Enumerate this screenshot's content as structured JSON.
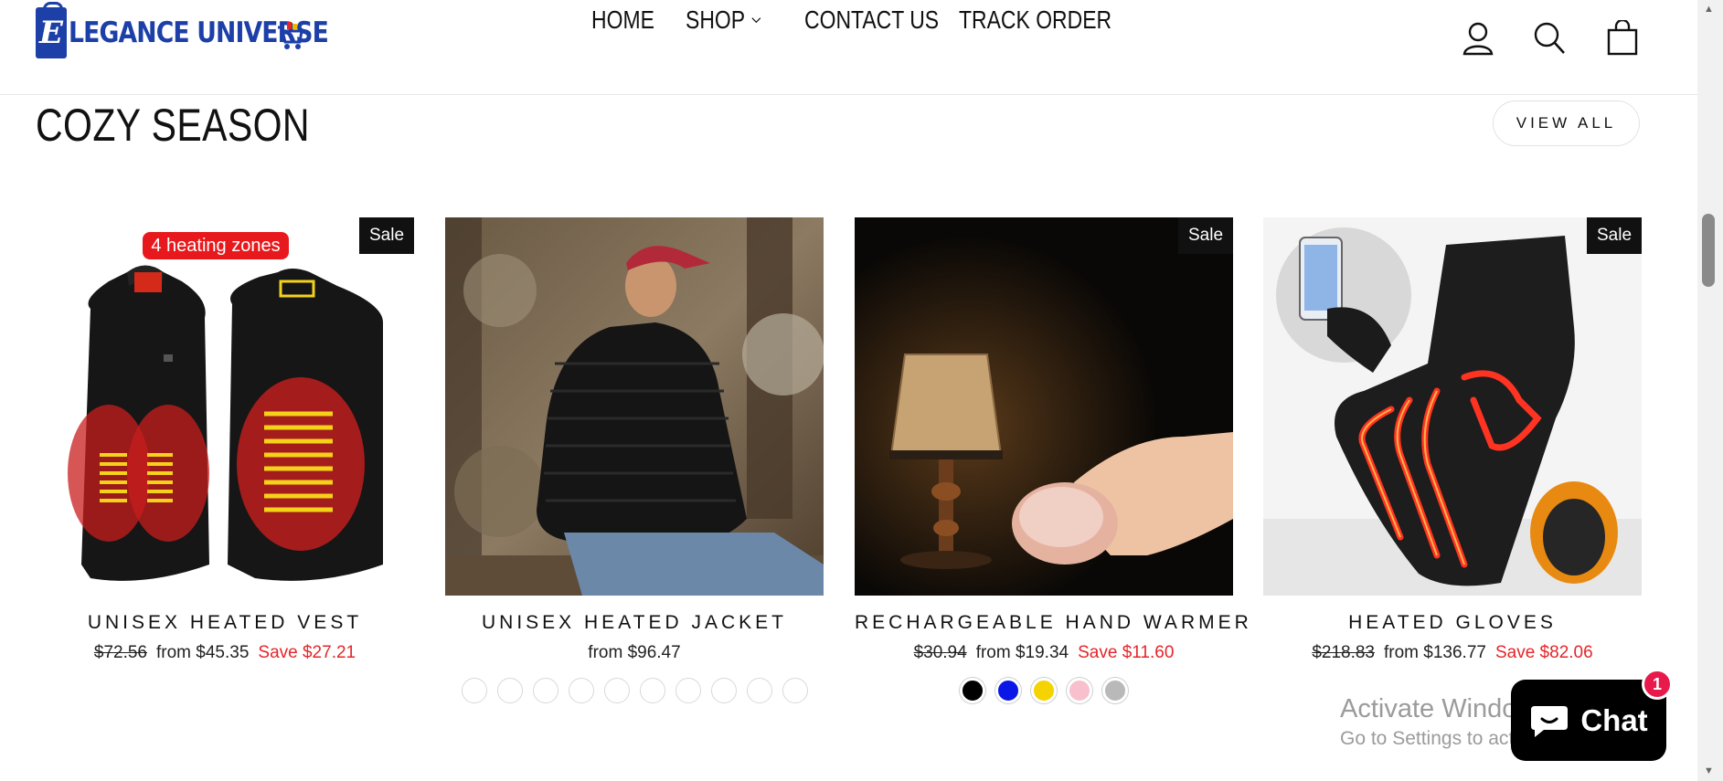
{
  "header": {
    "logo_text": "LEGANCE UNIVERSE",
    "logo_letter": "E",
    "nav": {
      "home": "HOME",
      "shop": "SHOP",
      "contact": "CONTACT US",
      "track": "TRACK ORDER"
    },
    "icons": [
      "user-icon",
      "search-icon",
      "bag-icon"
    ]
  },
  "section": {
    "title": "COZY SEASON",
    "view_all": "VIEW ALL"
  },
  "products": [
    {
      "name": "UNISEX HEATED VEST",
      "badge": "Sale",
      "original_price": "$72.56",
      "price": "from $45.35",
      "save": "Save $27.21",
      "image_label": "4 heating zones"
    },
    {
      "name": "UNISEX HEATED JACKET",
      "price": "from $96.47",
      "swatch_count": 10
    },
    {
      "name": "RECHARGEABLE HAND WARMER",
      "badge": "Sale",
      "original_price": "$30.94",
      "price": "from $19.34",
      "save": "Save $11.60",
      "swatches": [
        "#000000",
        "#0a17e6",
        "#f5d300",
        "#f8c0cc",
        "#b9b9b9"
      ]
    },
    {
      "name": "HEATED GLOVES",
      "badge": "Sale",
      "original_price": "$218.83",
      "price": "from $136.77",
      "save": "Save $82.06"
    }
  ],
  "overlay": {
    "activate_title": "Activate Windows",
    "activate_sub": "Go to Settings to activate Windows.",
    "chat_label": "Chat",
    "chat_count": "1"
  },
  "colors": {
    "brand": "#1c3fa8",
    "sale_text": "#e4262a",
    "badge_bg": "#111111",
    "chat_badge": "#e8194b"
  }
}
